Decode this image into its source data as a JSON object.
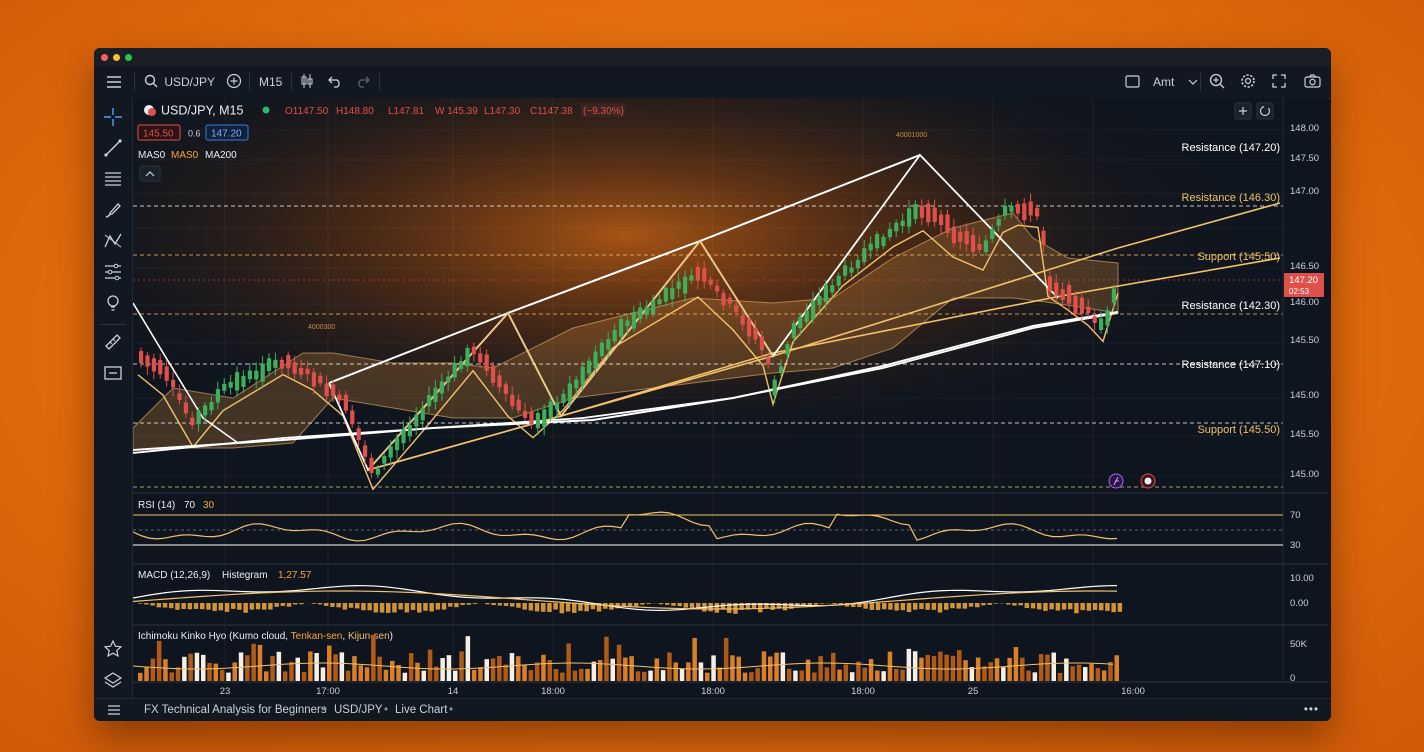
{
  "toolbar": {
    "symbol": "USD/JPY",
    "timeframe": "M15",
    "amount_label": "Amt"
  },
  "legend": {
    "title": "USD/JPY, M15",
    "ohlc": {
      "o": "O1147.50",
      "h": "H148.80",
      "l": "L147.81",
      "w": "W 145.39",
      "l2": "L147.30",
      "c": "C1147.38",
      "change": "(−9.30%)"
    },
    "bid": "145.50",
    "spread": "0.6",
    "ask": "147.20",
    "ma": [
      "MAS0",
      "MAS0",
      "MA200"
    ]
  },
  "price_axis": [
    "148.00",
    "147.50",
    "147.00",
    "146.50",
    "146.00",
    "145.50",
    "145.00",
    "145.50",
    "145.00"
  ],
  "current_price": {
    "value": "147.20",
    "countdown": "02:53"
  },
  "levels": [
    {
      "label": "Resistance (147.20)",
      "color": "#ffffff"
    },
    {
      "label": "Resistance (146.30)",
      "color": "#f2c16a"
    },
    {
      "label": "Support (145.50)",
      "color": "#f2c16a"
    },
    {
      "label": "Resistance (142.30)",
      "color": "#ffffff"
    },
    {
      "label": "Resistance (147.10)",
      "color": "#ffffff"
    },
    {
      "label": "Support (145.50)",
      "color": "#f2c16a"
    }
  ],
  "chart_notes": [
    "40001000",
    "4000300"
  ],
  "rsi": {
    "label": "RSI (14)",
    "upper": "70",
    "lower": "30",
    "ticks": [
      "70",
      "30"
    ]
  },
  "macd": {
    "label": "MACD (12,26,9)",
    "hist_label": "Histegram",
    "value": "1,27.57",
    "ticks": [
      "10.00",
      "0.00"
    ]
  },
  "ichimoku": {
    "prefix": "Ichimoku Kinko Hyo (Kumo cloud, ",
    "tenkan": "Tenkan-sen",
    "sep": ", ",
    "kijun": "Kijun-sen",
    "suffix": ")",
    "ticks": [
      "50K",
      "0"
    ]
  },
  "time_axis": [
    "23",
    "17:00",
    "14",
    "18:00",
    "18:00",
    "18:00",
    "25",
    "16:00"
  ],
  "status": {
    "items": [
      "FX Technical Analysis for Beginners",
      "USD/JPY",
      "Live Chart"
    ]
  },
  "colors": {
    "bull": "#3fae5a",
    "bear": "#e0504a",
    "accent": "#f2a93b",
    "background": "#0f151e"
  }
}
